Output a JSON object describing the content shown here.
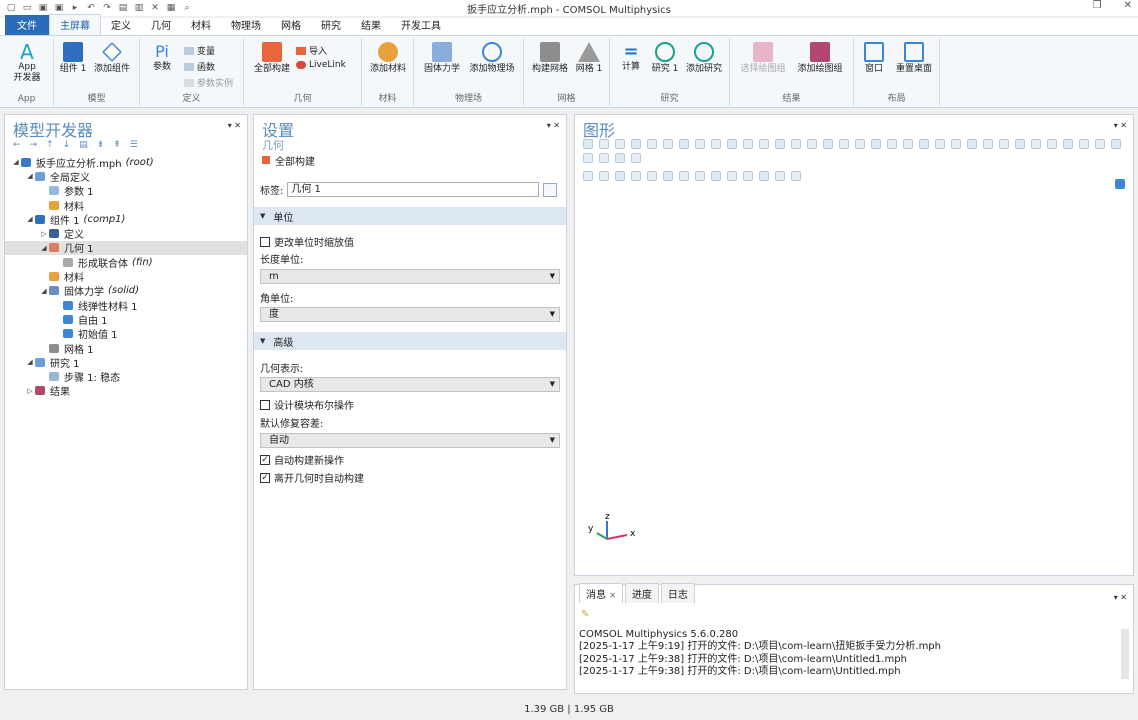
{
  "app": {
    "title": "扳手应立分析.mph - COMSOL Multiphysics"
  },
  "menu": {
    "file": "文件",
    "items": [
      "主屏幕",
      "定义",
      "几何",
      "材料",
      "物理场",
      "网格",
      "研究",
      "结果",
      "开发工具"
    ]
  },
  "ribbon": {
    "app": {
      "btn1": "App",
      "btn2": "开发器",
      "group": "App"
    },
    "model": {
      "component": "组件 1",
      "add_component": "添加组件",
      "group": "模型"
    },
    "definitions": {
      "params": "参数",
      "variables": "变量",
      "functions": "函数",
      "param_case": "参数实例",
      "group": "定义"
    },
    "geometry": {
      "build_all": "全部构建",
      "import": "导入",
      "livelink": "LiveLink",
      "group": "几何"
    },
    "materials": {
      "add_material": "添加材料",
      "group": "材料"
    },
    "physics": {
      "solid": "固体力学",
      "add_physics": "添加物理场",
      "group": "物理场"
    },
    "mesh": {
      "build_mesh": "构建网格",
      "mesh": "网格 1",
      "group": "网格"
    },
    "study": {
      "compute": "计算",
      "study": "研究 1",
      "add_study": "添加研究",
      "group": "研究"
    },
    "results": {
      "select_plot": "选择绘图组",
      "add_plot": "添加绘图组",
      "group": "结果"
    },
    "layout": {
      "window": "窗口",
      "reset": "重置桌面",
      "group": "布局"
    }
  },
  "model_builder": {
    "title": "模型开发器",
    "tree": [
      {
        "label": "扳手应立分析.mph",
        "suffix": "(root)",
        "level": 0,
        "toggle": "◢",
        "color": "#3a78c9"
      },
      {
        "label": "全局定义",
        "suffix": "",
        "level": 1,
        "toggle": "◢",
        "color": "#6a9fd4"
      },
      {
        "label": "参数 1",
        "suffix": "",
        "level": 2,
        "toggle": "",
        "color": "#9ab8dd"
      },
      {
        "label": "材料",
        "suffix": "",
        "level": 2,
        "toggle": "",
        "color": "#e9a23b"
      },
      {
        "label": "组件 1",
        "suffix": "(comp1)",
        "level": 1,
        "toggle": "◢",
        "color": "#2f6fbf"
      },
      {
        "label": "定义",
        "suffix": "",
        "level": 2,
        "toggle": "▷",
        "color": "#3a5f9c"
      },
      {
        "label": "几何 1",
        "suffix": "",
        "level": 2,
        "toggle": "◢",
        "color": "#e27a5e",
        "selected": true
      },
      {
        "label": "形成联合体",
        "suffix": "(fin)",
        "level": 3,
        "toggle": "",
        "color": "#a9a9a9"
      },
      {
        "label": "材料",
        "suffix": "",
        "level": 2,
        "toggle": "",
        "color": "#e9a23b"
      },
      {
        "label": "固体力学",
        "suffix": "(solid)",
        "level": 2,
        "toggle": "◢",
        "color": "#6a8fc4"
      },
      {
        "label": "线弹性材料 1",
        "suffix": "",
        "level": 3,
        "toggle": "",
        "color": "#3c86d8"
      },
      {
        "label": "自由 1",
        "suffix": "",
        "level": 3,
        "toggle": "",
        "color": "#3c86d8"
      },
      {
        "label": "初始值 1",
        "suffix": "",
        "level": 3,
        "toggle": "",
        "color": "#3c86d8"
      },
      {
        "label": "网格 1",
        "suffix": "",
        "level": 2,
        "toggle": "",
        "color": "#8d8d8d"
      },
      {
        "label": "研究 1",
        "suffix": "",
        "level": 1,
        "toggle": "◢",
        "color": "#6aa0d8"
      },
      {
        "label": "步骤 1: 稳态",
        "suffix": "",
        "level": 2,
        "toggle": "",
        "color": "#9bb7d4"
      },
      {
        "label": "结果",
        "suffix": "",
        "level": 1,
        "toggle": "▷",
        "color": "#b3466e"
      }
    ]
  },
  "settings": {
    "title": "设置",
    "subtitle": "几何",
    "node_label": "全部构建",
    "label_caption": "标签:",
    "label_value": "几何 1",
    "units_section": "单位",
    "scale_checkbox": "更改单位时缩放值",
    "length_unit_label": "长度单位:",
    "length_unit_value": "m",
    "angle_unit_label": "角单位:",
    "angle_unit_value": "度",
    "advanced_section": "高级",
    "geom_repr_label": "几何表示:",
    "geom_repr_value": "CAD 内核",
    "boolean_checkbox": "设计模块布尔操作",
    "repair_tol_label": "默认修复容差:",
    "repair_tol_value": "自动",
    "auto_build_checkbox": "自动构建新操作",
    "auto_build_leave_checkbox": "离开几何时自动构建",
    "checks": {
      "scale": false,
      "boolean": false,
      "auto_build": true,
      "auto_leave": true
    }
  },
  "graphics": {
    "title": "图形",
    "axes": {
      "x": "x",
      "y": "y",
      "z": "z"
    }
  },
  "messages": {
    "tabs": [
      "消息",
      "进度",
      "日志"
    ],
    "lines": [
      "COMSOL Multiphysics 5.6.0.280",
      "[2025-1-17 上午9:19] 打开的文件: D:\\项目\\com-learn\\扭矩扳手受力分析.mph",
      "[2025-1-17 上午9:38] 打开的文件: D:\\项目\\com-learn\\Untitled1.mph",
      "[2025-1-17 上午9:38] 打开的文件: D:\\项目\\com-learn\\Untitled.mph"
    ]
  },
  "status": {
    "memory": "1.39 GB | 1.95 GB"
  }
}
